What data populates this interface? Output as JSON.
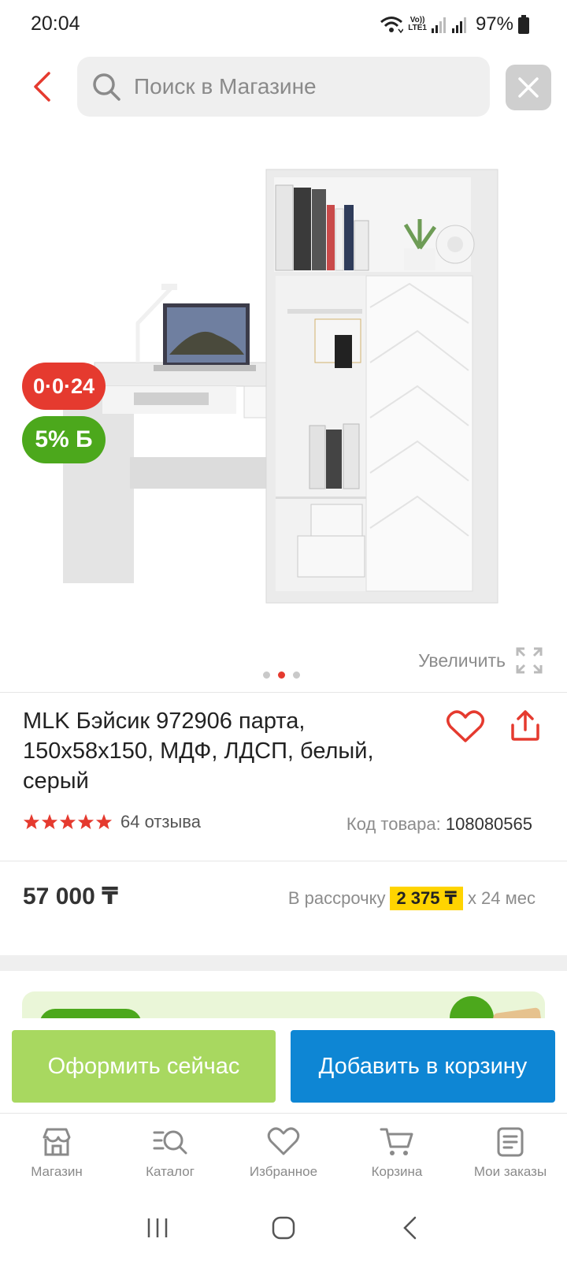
{
  "status_bar": {
    "time": "20:04",
    "volte_line1": "Vo))",
    "volte_line2": "LTE1",
    "battery": "97%",
    "icons": [
      "wifi-icon",
      "volte-icon",
      "signal-icon",
      "signal-icon",
      "battery-icon"
    ]
  },
  "search": {
    "placeholder": "Поиск в Магазине",
    "value": ""
  },
  "gallery": {
    "badge_installment": "0·0·24",
    "badge_bonus": "5% Б",
    "zoom_label": "Увеличить",
    "slide_count": 3,
    "active_slide": 2
  },
  "product": {
    "title": "MLK Бэйсик 972906 парта, 150x58x150, МДФ, ЛДСП, белый, серый",
    "rating": 5,
    "reviews": "64 отзыва",
    "sku_label": "Код товара:",
    "sku_value": "108080565",
    "price": "57 000 ₸",
    "installment_prefix": "В рассрочку",
    "installment_amount": "2 375 ₸",
    "installment_suffix": "x 24 мес"
  },
  "actions": {
    "checkout": "Оформить сейчас",
    "add_to_cart": "Добавить в корзину"
  },
  "bottom_nav": [
    {
      "label": "Магазин",
      "icon": "store-icon"
    },
    {
      "label": "Каталог",
      "icon": "catalog-search-icon"
    },
    {
      "label": "Избранное",
      "icon": "heart-icon"
    },
    {
      "label": "Корзина",
      "icon": "cart-icon"
    },
    {
      "label": "Мои заказы",
      "icon": "orders-icon"
    }
  ],
  "colors": {
    "accent_red": "#e53a2f",
    "bonus_green": "#4ca81c",
    "checkout_green": "#a8d860",
    "cart_blue": "#0e86d4",
    "installment_yellow": "#ffd400"
  }
}
